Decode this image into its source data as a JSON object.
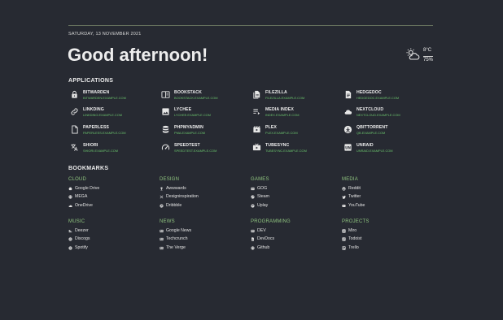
{
  "header": {
    "date": "SATURDAY, 13 NOVEMBER 2021",
    "greeting": "Good afternoon!"
  },
  "weather": {
    "icon": "partly-cloudy-day-icon",
    "temperature": "8°C",
    "humidity": "75%"
  },
  "applications": {
    "title": "APPLICATIONS",
    "items": [
      {
        "name": "BITWARDEN",
        "url": "BITWARDEN.EXAMPLE.COM",
        "icon": "lock-icon"
      },
      {
        "name": "BOOKSTACK",
        "url": "BOOKSTACK.EXAMPLE.COM",
        "icon": "book-icon"
      },
      {
        "name": "FILEZILLA",
        "url": "FILEZILLA.EXAMPLE.COM",
        "icon": "files-icon"
      },
      {
        "name": "HEDGEDOC",
        "url": "HEDGEDOC.EXAMPLE.COM",
        "icon": "document-icon"
      },
      {
        "name": "LINKDING",
        "url": "LINKDING.EXAMPLE.COM",
        "icon": "link-icon"
      },
      {
        "name": "LYCHEE",
        "url": "LYCHEE.EXAMPLE.COM",
        "icon": "image-icon"
      },
      {
        "name": "MEDIA INDEX",
        "url": "INDEX.EXAMPLE.COM",
        "icon": "playlist-icon"
      },
      {
        "name": "NEXTCLOUD",
        "url": "NEXTCLOUD.EXAMPLE.COM",
        "icon": "cloud-icon"
      },
      {
        "name": "PAPERLESS",
        "url": "PAPERLESS.EXAMPLE.COM",
        "icon": "file-icon"
      },
      {
        "name": "PHPMYADMIN",
        "url": "PMA.EXAMPLE.COM",
        "icon": "database-icon"
      },
      {
        "name": "PLEX",
        "url": "PLEX.EXAMPLE.COM",
        "icon": "movie-icon"
      },
      {
        "name": "QBITTORRENT",
        "url": "QB.EXAMPLE.COM",
        "icon": "download-icon"
      },
      {
        "name": "SHIORI",
        "url": "SHIORI.EXAMPLE.COM",
        "icon": "translate-icon"
      },
      {
        "name": "SPEEDTEST",
        "url": "SPEEDTEST.EXAMPLE.COM",
        "icon": "speedometer-icon"
      },
      {
        "name": "TUBESYNC",
        "url": "TUBESYNC.EXAMPLE.COM",
        "icon": "tv-icon"
      },
      {
        "name": "UNRAID",
        "url": "UNRAID.EXAMPLE.COM",
        "icon": "server-icon"
      }
    ]
  },
  "bookmarks": {
    "title": "BOOKMARKS",
    "groups": [
      {
        "title": "CLOUD",
        "items": [
          {
            "label": "Google Drive",
            "icon": "google-drive-icon"
          },
          {
            "label": "MEGA",
            "icon": "mega-icon"
          },
          {
            "label": "OneDrive",
            "icon": "onedrive-icon"
          }
        ]
      },
      {
        "title": "DESIGN",
        "items": [
          {
            "label": "Awwwards",
            "icon": "trophy-icon"
          },
          {
            "label": "Designinspiration",
            "icon": "tools-icon"
          },
          {
            "label": "Dribbble",
            "icon": "dribbble-icon"
          }
        ]
      },
      {
        "title": "GAMES",
        "items": [
          {
            "label": "GOG",
            "icon": "gog-icon"
          },
          {
            "label": "Steam",
            "icon": "steam-icon"
          },
          {
            "label": "Uplay",
            "icon": "uplay-icon"
          }
        ]
      },
      {
        "title": "MEDIA",
        "items": [
          {
            "label": "Reddit",
            "icon": "reddit-icon"
          },
          {
            "label": "Twitter",
            "icon": "twitter-icon"
          },
          {
            "label": "YouTube",
            "icon": "youtube-icon"
          }
        ]
      },
      {
        "title": "MUSIC",
        "items": [
          {
            "label": "Deezer",
            "icon": "deezer-icon"
          },
          {
            "label": "Discogs",
            "icon": "discogs-icon"
          },
          {
            "label": "Spotify",
            "icon": "spotify-icon"
          }
        ]
      },
      {
        "title": "NEWS",
        "items": [
          {
            "label": "Google News",
            "icon": "newspaper-icon"
          },
          {
            "label": "Techcrunch",
            "icon": "newspaper-icon"
          },
          {
            "label": "The Verge",
            "icon": "newspaper-icon"
          }
        ]
      },
      {
        "title": "PROGRAMMING",
        "items": [
          {
            "label": "DEV",
            "icon": "dev-icon"
          },
          {
            "label": "DevDocs",
            "icon": "devdocs-icon"
          },
          {
            "label": "Github",
            "icon": "github-icon"
          }
        ]
      },
      {
        "title": "PROJECTS",
        "items": [
          {
            "label": "Miro",
            "icon": "miro-icon"
          },
          {
            "label": "Todoist",
            "icon": "todoist-icon"
          },
          {
            "label": "Trello",
            "icon": "trello-icon"
          }
        ]
      }
    ]
  },
  "colors": {
    "background": "#272a32",
    "accent": "#8fc47f",
    "url": "#6bc46d",
    "text": "#ececec"
  }
}
